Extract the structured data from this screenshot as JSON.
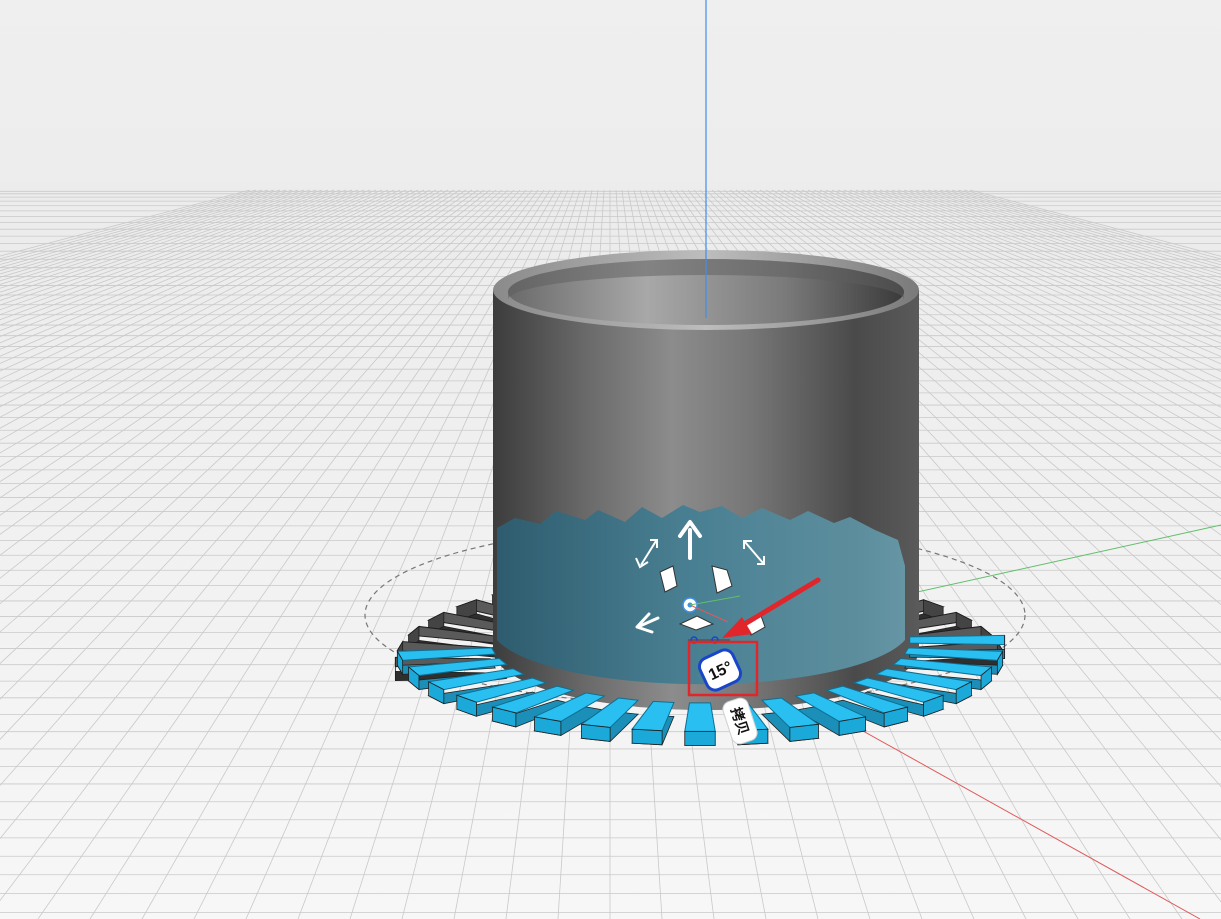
{
  "viewport": {
    "angle_label": "15°",
    "copy_label": "拷贝",
    "colors": {
      "background_top": "#efefef",
      "background_bottom": "#f6f6f6",
      "grid_line": "#c8c8c8",
      "cylinder_dark": "#3a3a3a",
      "cylinder_light": "#a9a9a9",
      "tooth_selected": "#29bff0",
      "tooth_unselected": "#4b4b4b",
      "axis_x": "#e05a5a",
      "axis_y": "#5fbf6a",
      "axis_z": "#3f8fe8",
      "annotation": "#e0262b",
      "angle_badge_border": "#1846c8"
    },
    "icons": [
      "move-up-arrow-icon",
      "move-left-arrow-icon",
      "move-diagonal-arrow-icon",
      "rotate-handle-icon",
      "scale-handle-icon",
      "pivot-point-icon"
    ]
  }
}
